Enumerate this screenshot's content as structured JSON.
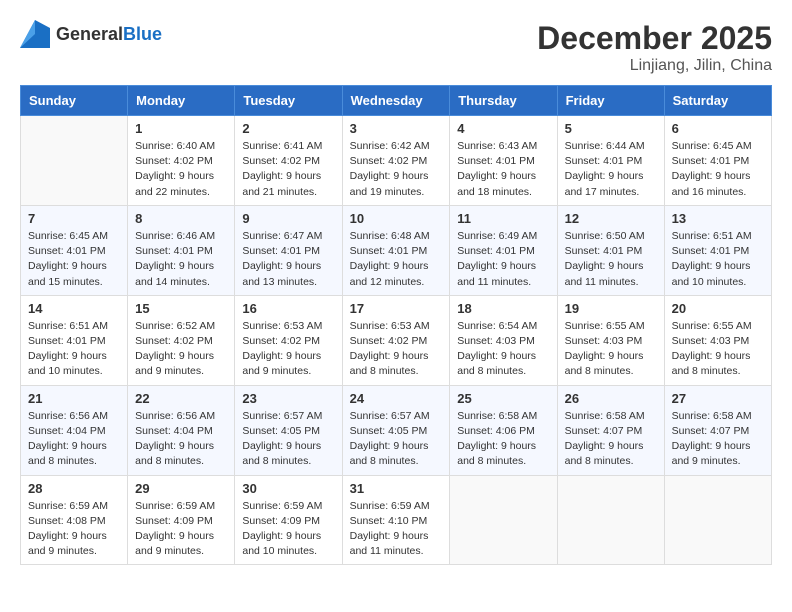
{
  "logo": {
    "general": "General",
    "blue": "Blue"
  },
  "header": {
    "month": "December 2025",
    "location": "Linjiang, Jilin, China"
  },
  "weekdays": [
    "Sunday",
    "Monday",
    "Tuesday",
    "Wednesday",
    "Thursday",
    "Friday",
    "Saturday"
  ],
  "weeks": [
    [
      {
        "day": "",
        "sunrise": "",
        "sunset": "",
        "daylight": ""
      },
      {
        "day": "1",
        "sunrise": "Sunrise: 6:40 AM",
        "sunset": "Sunset: 4:02 PM",
        "daylight": "Daylight: 9 hours and 22 minutes."
      },
      {
        "day": "2",
        "sunrise": "Sunrise: 6:41 AM",
        "sunset": "Sunset: 4:02 PM",
        "daylight": "Daylight: 9 hours and 21 minutes."
      },
      {
        "day": "3",
        "sunrise": "Sunrise: 6:42 AM",
        "sunset": "Sunset: 4:02 PM",
        "daylight": "Daylight: 9 hours and 19 minutes."
      },
      {
        "day": "4",
        "sunrise": "Sunrise: 6:43 AM",
        "sunset": "Sunset: 4:01 PM",
        "daylight": "Daylight: 9 hours and 18 minutes."
      },
      {
        "day": "5",
        "sunrise": "Sunrise: 6:44 AM",
        "sunset": "Sunset: 4:01 PM",
        "daylight": "Daylight: 9 hours and 17 minutes."
      },
      {
        "day": "6",
        "sunrise": "Sunrise: 6:45 AM",
        "sunset": "Sunset: 4:01 PM",
        "daylight": "Daylight: 9 hours and 16 minutes."
      }
    ],
    [
      {
        "day": "7",
        "sunrise": "Sunrise: 6:45 AM",
        "sunset": "Sunset: 4:01 PM",
        "daylight": "Daylight: 9 hours and 15 minutes."
      },
      {
        "day": "8",
        "sunrise": "Sunrise: 6:46 AM",
        "sunset": "Sunset: 4:01 PM",
        "daylight": "Daylight: 9 hours and 14 minutes."
      },
      {
        "day": "9",
        "sunrise": "Sunrise: 6:47 AM",
        "sunset": "Sunset: 4:01 PM",
        "daylight": "Daylight: 9 hours and 13 minutes."
      },
      {
        "day": "10",
        "sunrise": "Sunrise: 6:48 AM",
        "sunset": "Sunset: 4:01 PM",
        "daylight": "Daylight: 9 hours and 12 minutes."
      },
      {
        "day": "11",
        "sunrise": "Sunrise: 6:49 AM",
        "sunset": "Sunset: 4:01 PM",
        "daylight": "Daylight: 9 hours and 11 minutes."
      },
      {
        "day": "12",
        "sunrise": "Sunrise: 6:50 AM",
        "sunset": "Sunset: 4:01 PM",
        "daylight": "Daylight: 9 hours and 11 minutes."
      },
      {
        "day": "13",
        "sunrise": "Sunrise: 6:51 AM",
        "sunset": "Sunset: 4:01 PM",
        "daylight": "Daylight: 9 hours and 10 minutes."
      }
    ],
    [
      {
        "day": "14",
        "sunrise": "Sunrise: 6:51 AM",
        "sunset": "Sunset: 4:01 PM",
        "daylight": "Daylight: 9 hours and 10 minutes."
      },
      {
        "day": "15",
        "sunrise": "Sunrise: 6:52 AM",
        "sunset": "Sunset: 4:02 PM",
        "daylight": "Daylight: 9 hours and 9 minutes."
      },
      {
        "day": "16",
        "sunrise": "Sunrise: 6:53 AM",
        "sunset": "Sunset: 4:02 PM",
        "daylight": "Daylight: 9 hours and 9 minutes."
      },
      {
        "day": "17",
        "sunrise": "Sunrise: 6:53 AM",
        "sunset": "Sunset: 4:02 PM",
        "daylight": "Daylight: 9 hours and 8 minutes."
      },
      {
        "day": "18",
        "sunrise": "Sunrise: 6:54 AM",
        "sunset": "Sunset: 4:03 PM",
        "daylight": "Daylight: 9 hours and 8 minutes."
      },
      {
        "day": "19",
        "sunrise": "Sunrise: 6:55 AM",
        "sunset": "Sunset: 4:03 PM",
        "daylight": "Daylight: 9 hours and 8 minutes."
      },
      {
        "day": "20",
        "sunrise": "Sunrise: 6:55 AM",
        "sunset": "Sunset: 4:03 PM",
        "daylight": "Daylight: 9 hours and 8 minutes."
      }
    ],
    [
      {
        "day": "21",
        "sunrise": "Sunrise: 6:56 AM",
        "sunset": "Sunset: 4:04 PM",
        "daylight": "Daylight: 9 hours and 8 minutes."
      },
      {
        "day": "22",
        "sunrise": "Sunrise: 6:56 AM",
        "sunset": "Sunset: 4:04 PM",
        "daylight": "Daylight: 9 hours and 8 minutes."
      },
      {
        "day": "23",
        "sunrise": "Sunrise: 6:57 AM",
        "sunset": "Sunset: 4:05 PM",
        "daylight": "Daylight: 9 hours and 8 minutes."
      },
      {
        "day": "24",
        "sunrise": "Sunrise: 6:57 AM",
        "sunset": "Sunset: 4:05 PM",
        "daylight": "Daylight: 9 hours and 8 minutes."
      },
      {
        "day": "25",
        "sunrise": "Sunrise: 6:58 AM",
        "sunset": "Sunset: 4:06 PM",
        "daylight": "Daylight: 9 hours and 8 minutes."
      },
      {
        "day": "26",
        "sunrise": "Sunrise: 6:58 AM",
        "sunset": "Sunset: 4:07 PM",
        "daylight": "Daylight: 9 hours and 8 minutes."
      },
      {
        "day": "27",
        "sunrise": "Sunrise: 6:58 AM",
        "sunset": "Sunset: 4:07 PM",
        "daylight": "Daylight: 9 hours and 9 minutes."
      }
    ],
    [
      {
        "day": "28",
        "sunrise": "Sunrise: 6:59 AM",
        "sunset": "Sunset: 4:08 PM",
        "daylight": "Daylight: 9 hours and 9 minutes."
      },
      {
        "day": "29",
        "sunrise": "Sunrise: 6:59 AM",
        "sunset": "Sunset: 4:09 PM",
        "daylight": "Daylight: 9 hours and 9 minutes."
      },
      {
        "day": "30",
        "sunrise": "Sunrise: 6:59 AM",
        "sunset": "Sunset: 4:09 PM",
        "daylight": "Daylight: 9 hours and 10 minutes."
      },
      {
        "day": "31",
        "sunrise": "Sunrise: 6:59 AM",
        "sunset": "Sunset: 4:10 PM",
        "daylight": "Daylight: 9 hours and 11 minutes."
      },
      {
        "day": "",
        "sunrise": "",
        "sunset": "",
        "daylight": ""
      },
      {
        "day": "",
        "sunrise": "",
        "sunset": "",
        "daylight": ""
      },
      {
        "day": "",
        "sunrise": "",
        "sunset": "",
        "daylight": ""
      }
    ]
  ]
}
